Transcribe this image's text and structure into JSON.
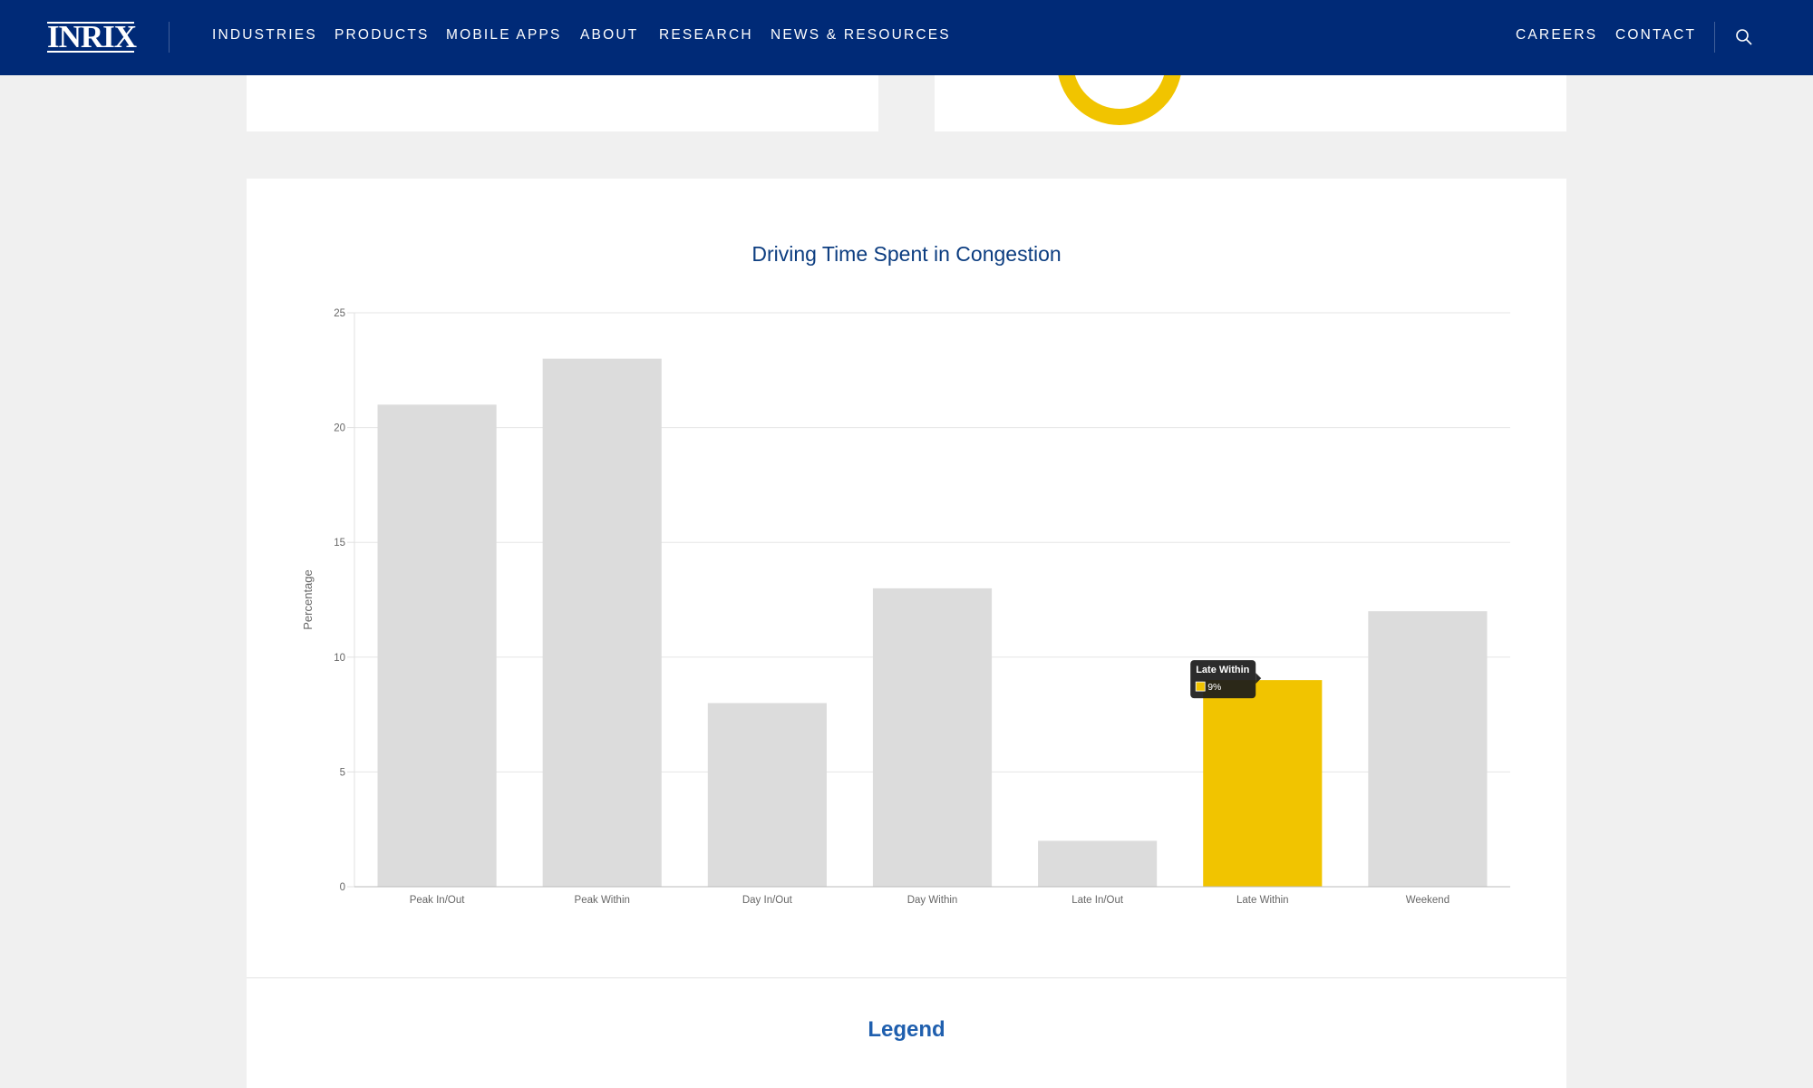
{
  "nav": {
    "logo": "INRIX",
    "items": [
      "INDUSTRIES",
      "PRODUCTS",
      "MOBILE APPS",
      "ABOUT",
      "RESEARCH",
      "NEWS & RESOURCES"
    ],
    "right_items": [
      "CAREERS",
      "CONTACT"
    ],
    "search_icon": "search-icon"
  },
  "colors": {
    "nav_bg": "#002a77",
    "bar_default": "#dcdcdc",
    "bar_highlight": "#f1c400",
    "title": "#0c3d80",
    "legend_heading": "#1f5fae",
    "tooltip_bg": "#1a1a1a"
  },
  "chart_data": {
    "type": "bar",
    "title": "Driving Time Spent in Congestion",
    "xlabel": "",
    "ylabel": "Percentage",
    "ylim": [
      0,
      25
    ],
    "yticks": [
      0,
      5,
      10,
      15,
      20,
      25
    ],
    "grid": true,
    "categories": [
      "Peak In/Out",
      "Peak Within",
      "Day In/Out",
      "Day Within",
      "Late In/Out",
      "Late Within",
      "Weekend"
    ],
    "values": [
      21,
      23,
      8,
      13,
      2,
      9,
      12
    ],
    "highlighted_category": "Late Within",
    "tooltip": {
      "title": "Late Within",
      "value": "9%"
    }
  },
  "legend": {
    "heading": "Legend"
  }
}
